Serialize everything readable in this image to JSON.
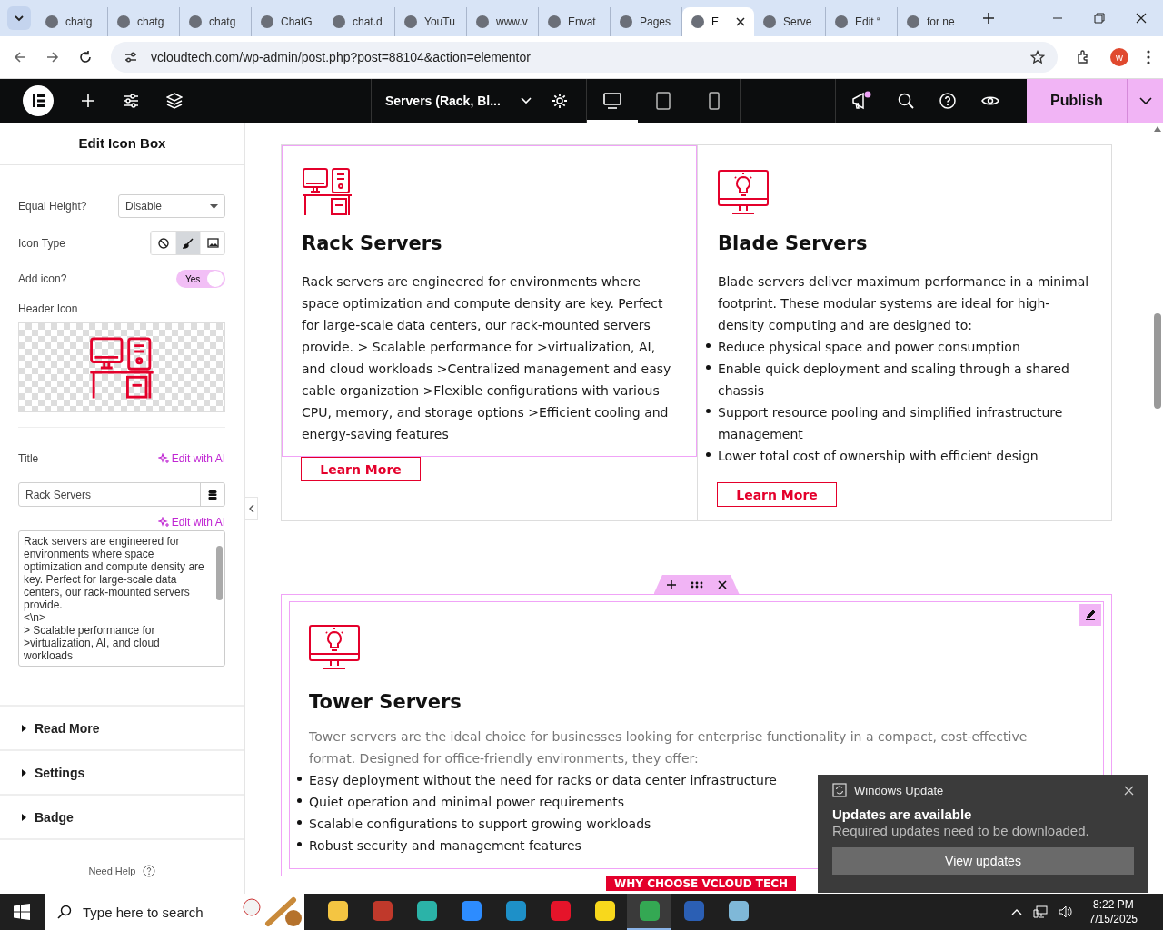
{
  "browser": {
    "tabs": [
      {
        "label": "chatg",
        "selected": false
      },
      {
        "label": "chatg",
        "selected": false
      },
      {
        "label": "chatg",
        "selected": false
      },
      {
        "label": "ChatG",
        "selected": false
      },
      {
        "label": "chat.d",
        "selected": false
      },
      {
        "label": "YouTu",
        "selected": false
      },
      {
        "label": "www.v",
        "selected": false
      },
      {
        "label": "Envat",
        "selected": false
      },
      {
        "label": "Pages",
        "selected": false
      },
      {
        "label": "E",
        "selected": true
      },
      {
        "label": "Serve",
        "selected": false
      },
      {
        "label": "Edit “",
        "selected": false
      },
      {
        "label": "for ne",
        "selected": false
      }
    ],
    "url": "vcloudtech.com/wp-admin/post.php?post=88104&action=elementor",
    "profile_initial": "w"
  },
  "editor_bar": {
    "page_title": "Servers (Rack, Bl...",
    "devices": [
      {
        "kind": "desktop",
        "selected": true
      },
      {
        "kind": "tablet",
        "selected": false
      },
      {
        "kind": "mobile",
        "selected": false
      }
    ],
    "publish": "Publish"
  },
  "panel": {
    "title": "Edit Icon Box",
    "equal_height": {
      "label": "Equal Height?",
      "value": "Disable"
    },
    "icon_type": {
      "label": "Icon Type",
      "options": [
        {
          "kind": "none",
          "selected": false
        },
        {
          "kind": "icon",
          "selected": true
        },
        {
          "kind": "image",
          "selected": false
        }
      ]
    },
    "add_icon": {
      "label": "Add icon?",
      "on": true,
      "text": "Yes"
    },
    "header_icon": {
      "label": "Header Icon"
    },
    "title_field": {
      "label": "Title",
      "ai": "Edit with AI",
      "value": "Rack Servers"
    },
    "description_field": {
      "ai": "Edit with AI",
      "value": "Rack servers are engineered for environments where space optimization and compute density are key. Perfect for large-scale data centers, our rack-mounted servers provide.\n<\\n>\n> Scalable performance for >virtualization, AI, and cloud workloads"
    },
    "sections": [
      {
        "label": "Read More",
        "expanded": false
      },
      {
        "label": "Settings",
        "expanded": false
      },
      {
        "label": "Badge",
        "expanded": false
      }
    ],
    "help": "Need Help"
  },
  "canvas": {
    "boxes": [
      {
        "title": "Rack Servers",
        "selected": true,
        "paragraph": "Rack servers are engineered for environments where space optimization and compute density are key. Perfect for large-scale data centers, our rack-mounted servers provide. > Scalable performance for >virtualization, AI, and cloud workloads >Centralized management and easy cable organization >Flexible configurations with various CPU, memory, and storage options >Efficient cooling and energy-saving features",
        "button": "Learn More"
      },
      {
        "title": "Blade Servers",
        "selected": false,
        "paragraph": "Blade servers deliver maximum performance in a minimal footprint. These modular systems are ideal for high-density computing and are designed to:",
        "bullets": [
          "Reduce physical space and power consumption",
          "Enable quick deployment and scaling through a shared chassis",
          "Support resource pooling and simplified infrastructure management",
          "Lower total cost of ownership with efficient design"
        ],
        "button": "Learn More"
      }
    ],
    "tower": {
      "selected": true,
      "title": "Tower Servers",
      "paragraph": "Tower servers are the ideal choice for businesses looking for enterprise functionality in a compact, cost-effective format. Designed for office-friendly environments, they offer:",
      "bullets": [
        "Easy deployment without the need for racks or data center infrastructure",
        "Quiet operation and minimal power requirements",
        "Scalable configurations to support growing workloads",
        "Robust security and management features"
      ]
    },
    "next_heading": "WHY CHOOSE VCLOUD TECH"
  },
  "notification": {
    "app": "Windows Update",
    "title": "Updates are available",
    "text": "Required updates need to be downloaded.",
    "button": "View updates"
  },
  "taskbar": {
    "search_placeholder": "Type here to search",
    "time": "8:22 PM",
    "date": "7/15/2025"
  }
}
